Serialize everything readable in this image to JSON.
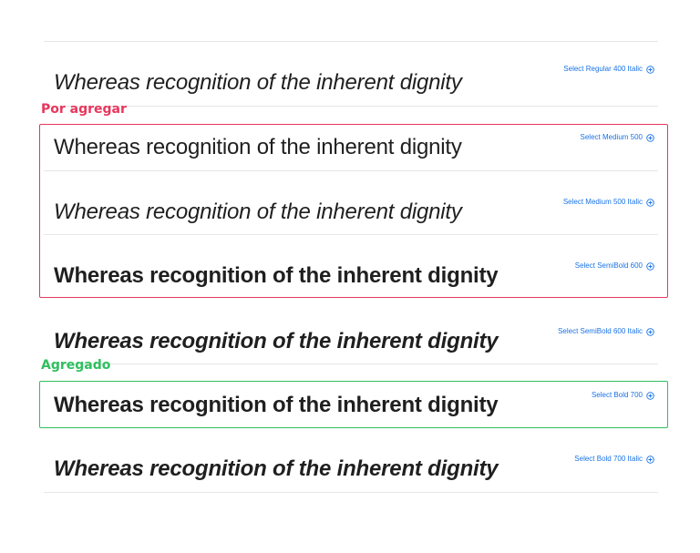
{
  "sample_text": "Whereas recognition of the inherent dignity",
  "styles": [
    {
      "select_label": "Select Regular 400 Italic"
    },
    {
      "select_label": "Select Medium 500"
    },
    {
      "select_label": "Select Medium 500 Italic"
    },
    {
      "select_label": "Select SemiBold 600"
    },
    {
      "select_label": "Select SemiBold 600 Italic"
    },
    {
      "select_label": "Select Bold 700"
    },
    {
      "select_label": "Select Bold 700 Italic"
    }
  ],
  "annotations": {
    "pending_label": "Por agregar",
    "added_label": "Agregado"
  },
  "colors": {
    "link": "#1a73e8",
    "pending": "#e8365d",
    "added": "#2fc05f"
  },
  "icons": {
    "select": "plus-circle-icon"
  }
}
